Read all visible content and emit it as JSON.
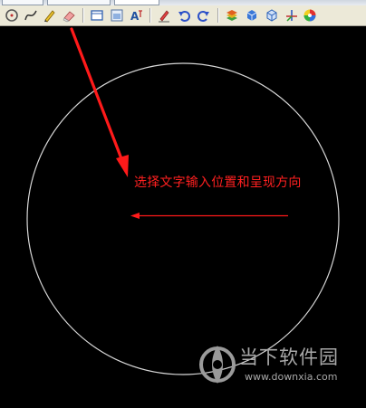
{
  "toolbar": {
    "buttons": [
      {
        "name": "circle-tool-icon"
      },
      {
        "name": "curve-tool-icon"
      },
      {
        "name": "pencil-tool-icon"
      },
      {
        "name": "eraser-tool-icon"
      },
      {
        "name": "rectangle-tool-icon"
      },
      {
        "name": "image-tool-icon"
      },
      {
        "name": "text-tool-icon"
      },
      {
        "name": "clear-tool-icon"
      },
      {
        "name": "undo-icon"
      },
      {
        "name": "redo-icon"
      },
      {
        "name": "layers-icon"
      },
      {
        "name": "cube-solid-icon"
      },
      {
        "name": "cube-wire-icon"
      },
      {
        "name": "axes-icon"
      },
      {
        "name": "color-palette-icon"
      }
    ]
  },
  "canvas": {
    "caption": "选择文字输入位置和呈现方向",
    "colors": {
      "background": "#000000",
      "circle": "#d8d8d8",
      "annotation": "#ff1a1a"
    }
  },
  "watermark": {
    "title": "当下软件园",
    "url": "www.downxia.com"
  }
}
